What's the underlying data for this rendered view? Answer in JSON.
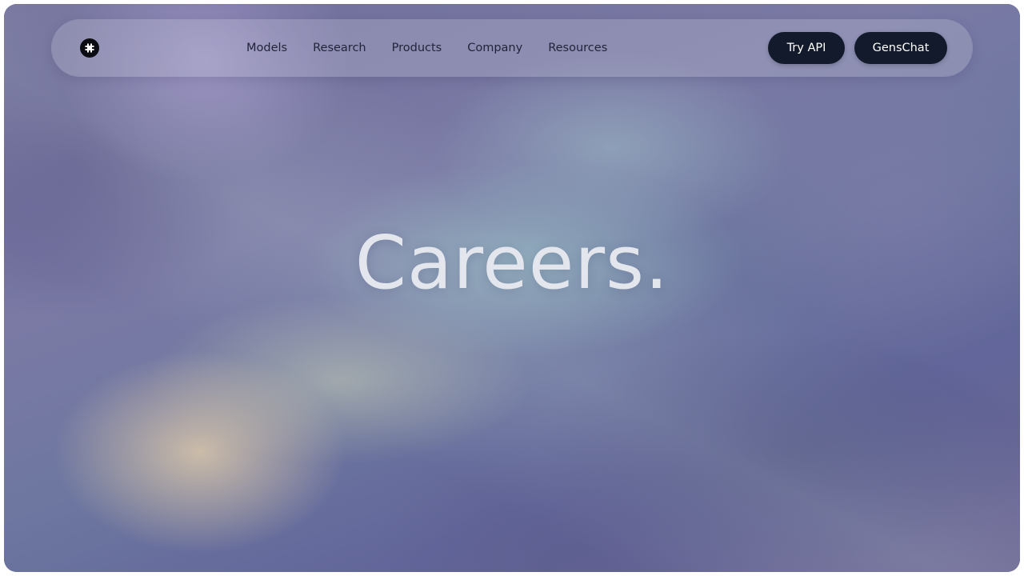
{
  "nav": {
    "logo_icon": "brand-logo-icon",
    "links": [
      {
        "label": "Models"
      },
      {
        "label": "Research"
      },
      {
        "label": "Products"
      },
      {
        "label": "Company"
      },
      {
        "label": "Resources"
      }
    ],
    "try_api_label": "Try API",
    "genschat_label": "GensChat"
  },
  "hero": {
    "title": "Careers."
  },
  "colors": {
    "button_bg": "#121a2b",
    "button_text": "#ffffff",
    "nav_text": "#22253a",
    "title_text": "#e4e6ee"
  }
}
